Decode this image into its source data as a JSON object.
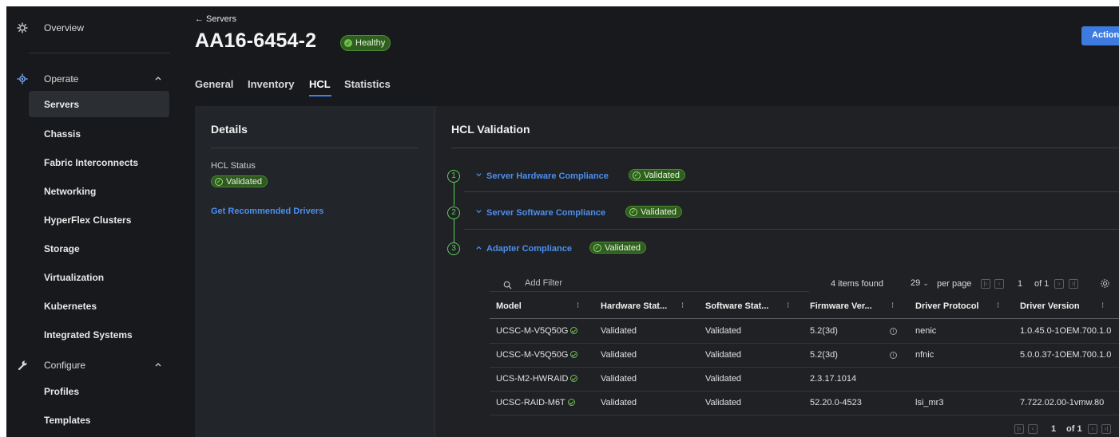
{
  "sidebar": {
    "items": [
      {
        "label": "Overview",
        "icon": "overview-icon"
      },
      {
        "label": "Operate",
        "icon": "operate-icon"
      },
      {
        "label": "Servers"
      },
      {
        "label": "Chassis"
      },
      {
        "label": "Fabric Interconnects"
      },
      {
        "label": "Networking"
      },
      {
        "label": "HyperFlex Clusters"
      },
      {
        "label": "Storage"
      },
      {
        "label": "Virtualization"
      },
      {
        "label": "Kubernetes"
      },
      {
        "label": "Integrated Systems"
      },
      {
        "label": "Configure",
        "icon": "configure-icon"
      },
      {
        "label": "Profiles"
      },
      {
        "label": "Templates"
      }
    ]
  },
  "header": {
    "breadcrumb": "← Servers",
    "title": "AA16-6454-2",
    "health": "Healthy",
    "action_label": "Action"
  },
  "tabs": [
    "General",
    "Inventory",
    "HCL",
    "Statistics"
  ],
  "details": {
    "title": "Details",
    "hcl_status_label": "HCL Status",
    "hcl_status_value": "Validated",
    "drivers_link": "Get Recommended Drivers"
  },
  "hcl": {
    "title": "HCL Validation",
    "steps": [
      {
        "num": "1",
        "label": "Server Hardware Compliance",
        "status": "Validated"
      },
      {
        "num": "2",
        "label": "Server Software Compliance",
        "status": "Validated"
      },
      {
        "num": "3",
        "label": "Adapter Compliance",
        "status": "Validated"
      }
    ],
    "filter_placeholder": "Add Filter",
    "items_found": "4 items found",
    "per_page_value": "29",
    "per_page_label": "per page",
    "page_current": "1",
    "page_total": "of 1",
    "columns": [
      "Model",
      "Hardware Stat...",
      "Software Stat...",
      "Firmware Ver...",
      "Driver Protocol",
      "Driver Version"
    ],
    "rows": [
      {
        "model": "UCSC-M-V5Q50G",
        "hw": "Validated",
        "sw": "Validated",
        "fw": "5.2(3d)",
        "protocol": "nenic",
        "driver": "1.0.45.0-1OEM.700.1.0"
      },
      {
        "model": "UCSC-M-V5Q50G",
        "hw": "Validated",
        "sw": "Validated",
        "fw": "5.2(3d)",
        "protocol": "nfnic",
        "driver": "5.0.0.37-1OEM.700.1.0"
      },
      {
        "model": "UCS-M2-HWRAID",
        "hw": "Validated",
        "sw": "Validated",
        "fw": "2.3.17.1014",
        "protocol": "",
        "driver": ""
      },
      {
        "model": "UCSC-RAID-M6T",
        "hw": "Validated",
        "sw": "Validated",
        "fw": "52.20.0-4523",
        "protocol": "lsi_mr3",
        "driver": "7.722.02.00-1vmw.80"
      }
    ],
    "bottom_page_current": "1",
    "bottom_page_total": "of 1"
  },
  "colors": {
    "accent": "#3d82f0",
    "success": "#6fc04a",
    "background": "#17191c"
  }
}
